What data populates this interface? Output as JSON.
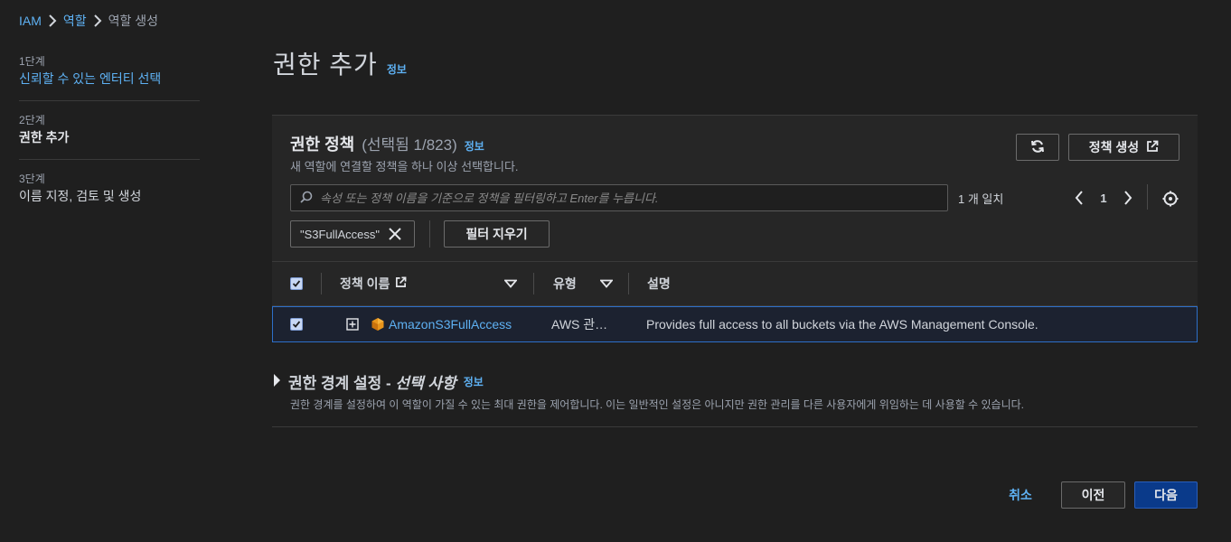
{
  "breadcrumb": [
    {
      "label": "IAM",
      "link": true
    },
    {
      "label": "역할",
      "link": true
    },
    {
      "label": "역할 생성",
      "link": false
    }
  ],
  "steps": [
    {
      "num": "1단계",
      "title": "신뢰할 수 있는 엔터티 선택",
      "state": "link"
    },
    {
      "num": "2단계",
      "title": "권한 추가",
      "state": "current"
    },
    {
      "num": "3단계",
      "title": "이름 지정, 검토 및 생성",
      "state": "pending"
    }
  ],
  "header": {
    "title": "권한 추가",
    "info": "정보"
  },
  "policies": {
    "title": "권한 정책",
    "count": "(선택됨 1/823)",
    "info": "정보",
    "description": "새 역할에 연결할 정책을 하나 이상 선택합니다.",
    "create_button": "정책 생성",
    "search_placeholder": "속성 또는 정책 이름을 기준으로 정책을 필터링하고 Enter를 누릅니다.",
    "match_count": "1 개 일치",
    "page": "1",
    "filter_token": "\"S3FullAccess\"",
    "clear_filters": "필터 지우기",
    "columns": {
      "name": "정책 이름",
      "type": "유형",
      "description": "설명"
    },
    "rows": [
      {
        "name": "AmazonS3FullAccess",
        "type": "AWS 관…",
        "description": "Provides full access to all buckets via the AWS Management Console.",
        "checked": true
      }
    ]
  },
  "boundary": {
    "title_prefix": "권한 경계 설정 - ",
    "title_optional": "선택 사항",
    "info": "정보",
    "description": "권한 경계를 설정하여 이 역할이 가질 수 있는 최대 권한을 제어합니다. 이는 일반적인 설정은 아니지만 권한 관리를 다른 사용자에게 위임하는 데 사용할 수 있습니다."
  },
  "footer": {
    "cancel": "취소",
    "prev": "이전",
    "next": "다음"
  },
  "colors": {
    "link": "#5eb1f3",
    "primary": "#0a3a8a",
    "background": "#1f1f1f",
    "panel": "#262626",
    "selected_border": "#2d6fc9"
  }
}
